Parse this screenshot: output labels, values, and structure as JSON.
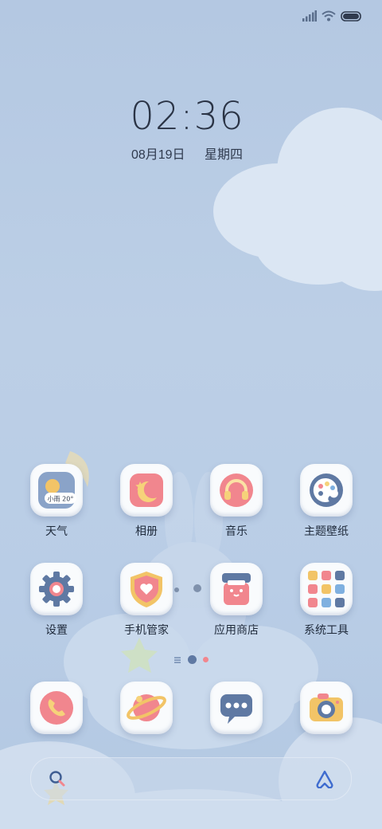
{
  "lockscreen": {
    "time": "02:36",
    "date": "08月19日",
    "weekday": "星期四"
  },
  "weather_widget": {
    "condition": "小雨",
    "temperature": "20°"
  },
  "apps": [
    {
      "label": "天气",
      "icon": "weather-icon"
    },
    {
      "label": "相册",
      "icon": "gallery-icon"
    },
    {
      "label": "音乐",
      "icon": "music-icon"
    },
    {
      "label": "主题壁纸",
      "icon": "theme-icon"
    },
    {
      "label": "设置",
      "icon": "settings-icon"
    },
    {
      "label": "手机管家",
      "icon": "security-icon"
    },
    {
      "label": "应用商店",
      "icon": "app-store-icon"
    },
    {
      "label": "系统工具",
      "icon": "tools-folder-icon"
    }
  ],
  "dock": [
    {
      "icon": "phone-icon"
    },
    {
      "icon": "browser-icon"
    },
    {
      "icon": "messages-icon"
    },
    {
      "icon": "camera-icon"
    }
  ],
  "pager": {
    "pages": 2,
    "current": 1
  },
  "colors": {
    "background": "#b9cde6",
    "text": "#1f2a3b",
    "accent": "#f28a92"
  }
}
